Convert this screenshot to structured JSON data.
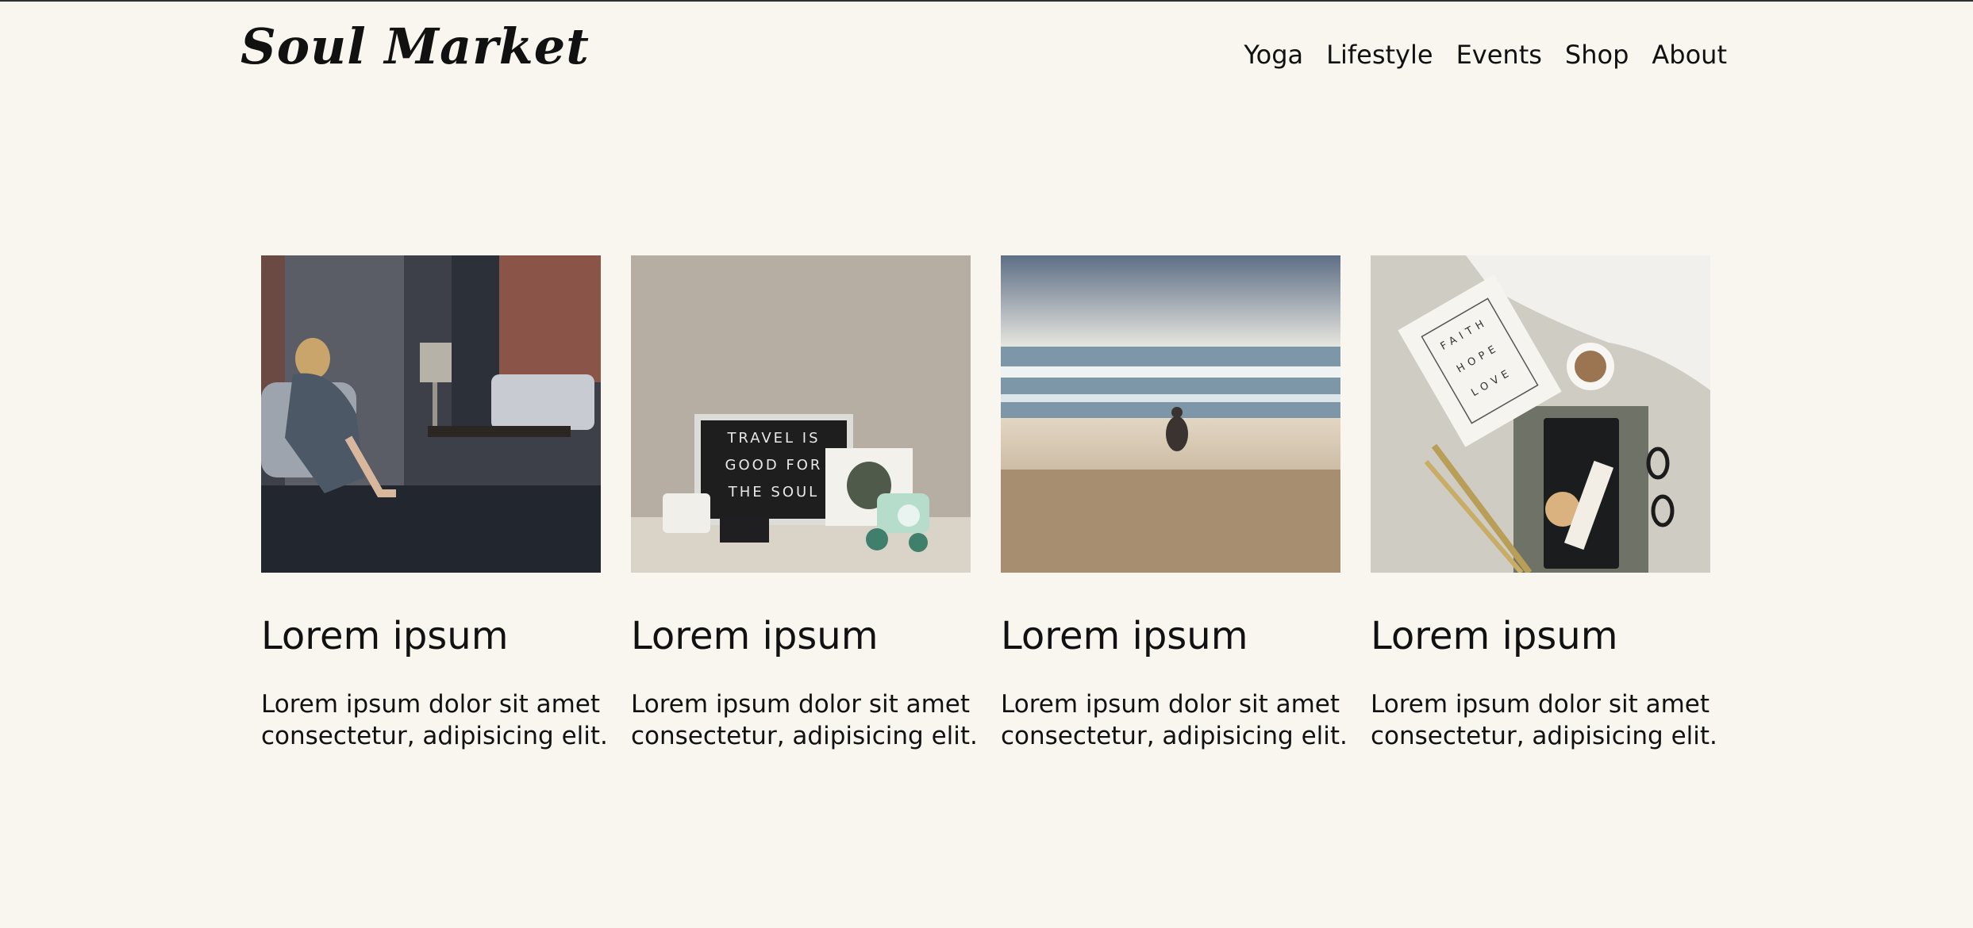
{
  "site": {
    "logo": "Soul Market",
    "nav": [
      "Yoga",
      "Lifestyle",
      "Events",
      "Shop",
      "About"
    ]
  },
  "cards": [
    {
      "title": "Lorem ipsum",
      "line1": "Lorem ipsum dolor sit amet",
      "line2": "consectetur, adipisicing elit.",
      "image": "woman-reading-in-living-room"
    },
    {
      "title": "Lorem ipsum",
      "line1": "Lorem ipsum dolor sit amet",
      "line2": "consectetur, adipisicing elit.",
      "image": "travel-letterboard-still-life",
      "sign": [
        "TRAVEL IS",
        "GOOD FOR",
        "THE SOUL"
      ]
    },
    {
      "title": "Lorem ipsum",
      "line1": "Lorem ipsum dolor sit amet",
      "line2": "consectetur, adipisicing elit.",
      "image": "meditating-on-beach"
    },
    {
      "title": "Lorem ipsum",
      "line1": "Lorem ipsum dolor sit amet",
      "line2": "consectetur, adipisicing elit.",
      "image": "faith-hope-love-flatlay",
      "card_text": [
        "FAITH",
        "HOPE",
        "LOVE"
      ]
    }
  ],
  "colors": {
    "background": "#f8f6ef",
    "text": "#111111"
  }
}
